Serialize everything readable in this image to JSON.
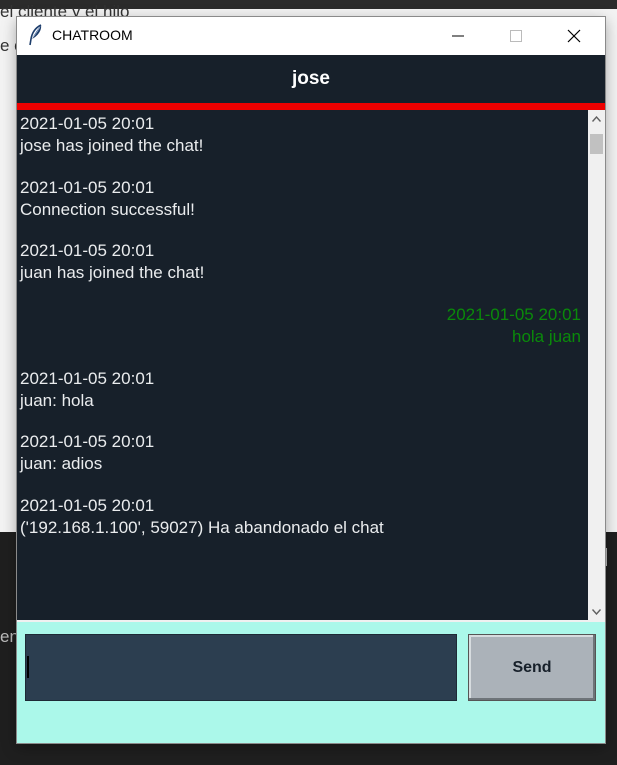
{
  "background": {
    "text_line_1": "el cliente y el hilo",
    "text_line_2": "e c",
    "text_line_3": "en"
  },
  "window": {
    "title": "CHATROOM",
    "icon": "feather-icon",
    "controls": [
      "minimize-icon",
      "maximize-icon",
      "close-icon"
    ]
  },
  "header": {
    "username": "jose"
  },
  "messages": [
    {
      "timestamp": "2021-01-05 20:01",
      "text": "jose has joined the chat!",
      "align": "left"
    },
    {
      "timestamp": "2021-01-05 20:01",
      "text": "Connection successful!",
      "align": "left"
    },
    {
      "timestamp": "2021-01-05 20:01",
      "text": "juan has joined the chat!",
      "align": "left"
    },
    {
      "timestamp": "2021-01-05 20:01",
      "text": "hola juan",
      "align": "right"
    },
    {
      "timestamp": "2021-01-05 20:01",
      "text": "juan: hola",
      "align": "left"
    },
    {
      "timestamp": "2021-01-05 20:01",
      "text": "juan: adios",
      "align": "left"
    },
    {
      "timestamp": "2021-01-05 20:01",
      "text": "('192.168.1.100', 59027) Ha abandonado el chat",
      "align": "left"
    }
  ],
  "input": {
    "value": ""
  },
  "send_label": "Send",
  "colors": {
    "chat_bg": "#17202a",
    "header_accent": "#ee0000",
    "own_message": "#0a8a0a",
    "bottom_panel": "#abf8ea",
    "input_bg": "#2c3e50",
    "send_button": "#abb2b9"
  }
}
